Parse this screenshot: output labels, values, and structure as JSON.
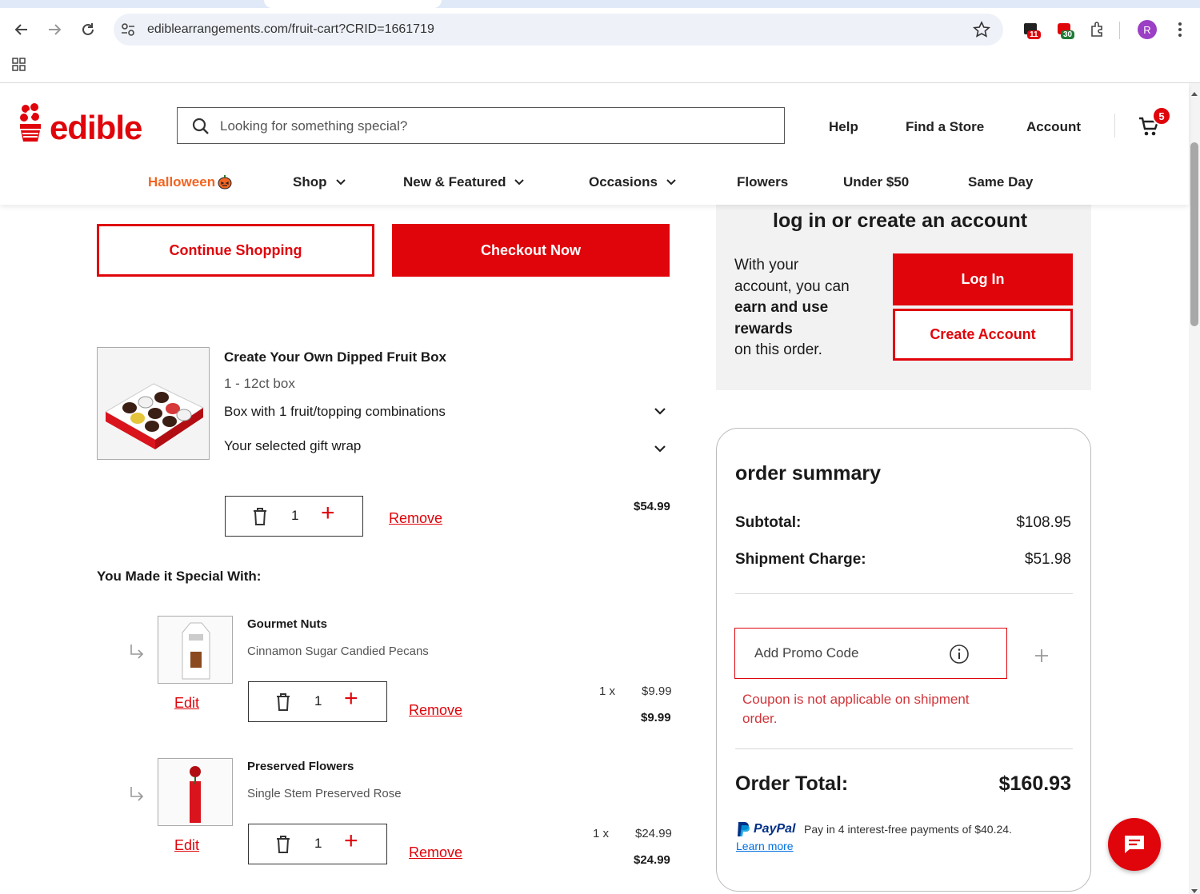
{
  "browser": {
    "url": "ediblearrangements.com/fruit-cart?CRID=1661719",
    "ext_badge_1": "11",
    "ext_badge_2": "30",
    "profile_initial": "R"
  },
  "header": {
    "logo": "edible",
    "search_placeholder": "Looking for something special?",
    "links": {
      "help": "Help",
      "find_store": "Find a Store",
      "account": "Account"
    },
    "cart_count": "5"
  },
  "menu": {
    "halloween": "Halloween",
    "shop": "Shop",
    "new_featured": "New & Featured",
    "occasions": "Occasions",
    "flowers": "Flowers",
    "under50": "Under $50",
    "same_day": "Same Day"
  },
  "cart": {
    "continue_label": "Continue Shopping",
    "checkout_label": "Checkout Now",
    "main_item": {
      "name": "Create Your Own Dipped Fruit Box",
      "size": "1 - 12ct box",
      "option1": "Box with 1 fruit/topping combinations",
      "option2": "Your selected gift wrap",
      "qty": "1",
      "remove": "Remove",
      "price": "$54.99"
    },
    "special_heading": "You Made it Special With:",
    "addons": [
      {
        "name": "Gourmet Nuts",
        "desc": "Cinnamon Sugar Candied Pecans",
        "edit": "Edit",
        "qty": "1",
        "remove": "Remove",
        "unit_qty": "1 x",
        "unit_price": "$9.99",
        "total": "$9.99"
      },
      {
        "name": "Preserved Flowers",
        "desc": "Single Stem Preserved Rose",
        "edit": "Edit",
        "qty": "1",
        "remove": "Remove",
        "unit_qty": "1 x",
        "unit_price": "$24.99",
        "total": "$24.99"
      }
    ]
  },
  "login": {
    "title": "log in or create an account",
    "text_1": "With your",
    "text_2": "account, you can",
    "text_bold_1": "earn and use",
    "text_bold_2": "rewards",
    "text_3": "on this order.",
    "login_label": "Log In",
    "create_label": "Create Account"
  },
  "summary": {
    "title": "order summary",
    "subtotal_label": "Subtotal:",
    "subtotal": "$108.95",
    "shipment_label": "Shipment Charge:",
    "shipment": "$51.98",
    "promo_placeholder": "Add Promo Code",
    "coupon_error_1": "Coupon is not applicable on shipment",
    "coupon_error_2": "order.",
    "total_label": "Order Total:",
    "total": "$160.93",
    "paypal_brand": "PayPal",
    "paypal_text": "Pay in 4 interest-free payments of $40.24.",
    "learn_more": "Learn more"
  },
  "colors": {
    "brand_red": "#e0040b",
    "halloween_orange": "#f26522",
    "paypal_blue": "#003087"
  }
}
